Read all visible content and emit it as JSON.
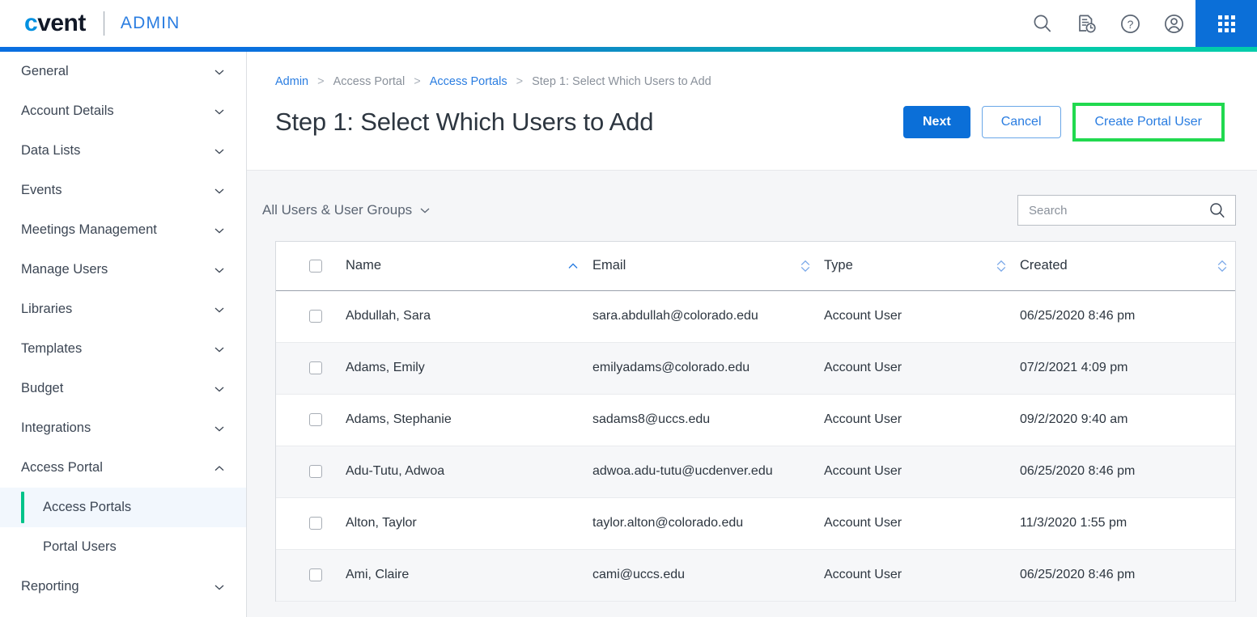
{
  "header": {
    "logo_c": "c",
    "logo_rest": "vent",
    "product": "ADMIN",
    "icons": [
      {
        "name": "search-icon",
        "label": "Search"
      },
      {
        "name": "recent-documents-icon",
        "label": "Recent"
      },
      {
        "name": "help-circle-icon",
        "label": "Help"
      },
      {
        "name": "account-circle-icon",
        "label": "Account"
      }
    ],
    "app_switcher": "app-grid-icon"
  },
  "colors": {
    "brand_blue": "#0b6fd8",
    "logo_blue": "#0090e0",
    "link_blue": "#2a7de1",
    "accent_teal": "#00c389",
    "highlight_green": "#21d94f",
    "content_bg": "#f5f6f8",
    "row_alt_bg": "#f6f7f9"
  },
  "sidebar": {
    "items": [
      {
        "label": "General",
        "expanded": false,
        "chevron": "chevron-down-icon"
      },
      {
        "label": "Account Details",
        "expanded": false,
        "chevron": "chevron-down-icon"
      },
      {
        "label": "Data Lists",
        "expanded": false,
        "chevron": "chevron-down-icon"
      },
      {
        "label": "Events",
        "expanded": false,
        "chevron": "chevron-down-icon"
      },
      {
        "label": "Meetings Management",
        "expanded": false,
        "chevron": "chevron-down-icon"
      },
      {
        "label": "Manage Users",
        "expanded": false,
        "chevron": "chevron-down-icon"
      },
      {
        "label": "Libraries",
        "expanded": false,
        "chevron": "chevron-down-icon"
      },
      {
        "label": "Templates",
        "expanded": false,
        "chevron": "chevron-down-icon"
      },
      {
        "label": "Budget",
        "expanded": false,
        "chevron": "chevron-down-icon"
      },
      {
        "label": "Integrations",
        "expanded": false,
        "chevron": "chevron-down-icon"
      },
      {
        "label": "Access Portal",
        "expanded": true,
        "chevron": "chevron-up-icon"
      },
      {
        "label": "Reporting",
        "expanded": false,
        "chevron": "chevron-down-icon"
      }
    ],
    "access_portal_children": [
      {
        "label": "Access Portals",
        "active": true
      },
      {
        "label": "Portal Users",
        "active": false
      }
    ]
  },
  "breadcrumb": [
    {
      "label": "Admin",
      "link": true
    },
    {
      "label": "Access Portal",
      "link": false
    },
    {
      "label": "Access Portals",
      "link": true
    },
    {
      "label": "Step 1: Select Which Users to Add",
      "link": false
    }
  ],
  "breadcrumb_separator": ">",
  "page": {
    "title": "Step 1: Select Which Users to Add"
  },
  "actions": {
    "next_label": "Next",
    "cancel_label": "Cancel",
    "create_portal_user_label": "Create Portal User",
    "create_portal_user_highlighted": true
  },
  "toolbar": {
    "filter_label": "All Users & User Groups",
    "filter_chevron": "chevron-down-icon",
    "search_placeholder": "Search",
    "search_value": "",
    "search_icon": "search-icon"
  },
  "table": {
    "select_all_checked": false,
    "columns": [
      {
        "key": "name",
        "label": "Name",
        "sort": "asc"
      },
      {
        "key": "email",
        "label": "Email",
        "sort": "none"
      },
      {
        "key": "type",
        "label": "Type",
        "sort": "none"
      },
      {
        "key": "created",
        "label": "Created",
        "sort": "none"
      }
    ],
    "rows": [
      {
        "checked": false,
        "name": "Abdullah, Sara",
        "email": "sara.abdullah@colorado.edu",
        "type": "Account User",
        "created": "06/25/2020 8:46 pm"
      },
      {
        "checked": false,
        "name": "Adams, Emily",
        "email": "emilyadams@colorado.edu",
        "type": "Account User",
        "created": "07/2/2021 4:09 pm"
      },
      {
        "checked": false,
        "name": "Adams, Stephanie",
        "email": "sadams8@uccs.edu",
        "type": "Account User",
        "created": "09/2/2020 9:40 am"
      },
      {
        "checked": false,
        "name": "Adu-Tutu, Adwoa",
        "email": "adwoa.adu-tutu@ucdenver.edu",
        "type": "Account User",
        "created": "06/25/2020 8:46 pm"
      },
      {
        "checked": false,
        "name": "Alton, Taylor",
        "email": "taylor.alton@colorado.edu",
        "type": "Account User",
        "created": "11/3/2020 1:55 pm"
      },
      {
        "checked": false,
        "name": "Ami, Claire",
        "email": "cami@uccs.edu",
        "type": "Account User",
        "created": "06/25/2020 8:46 pm"
      }
    ]
  }
}
